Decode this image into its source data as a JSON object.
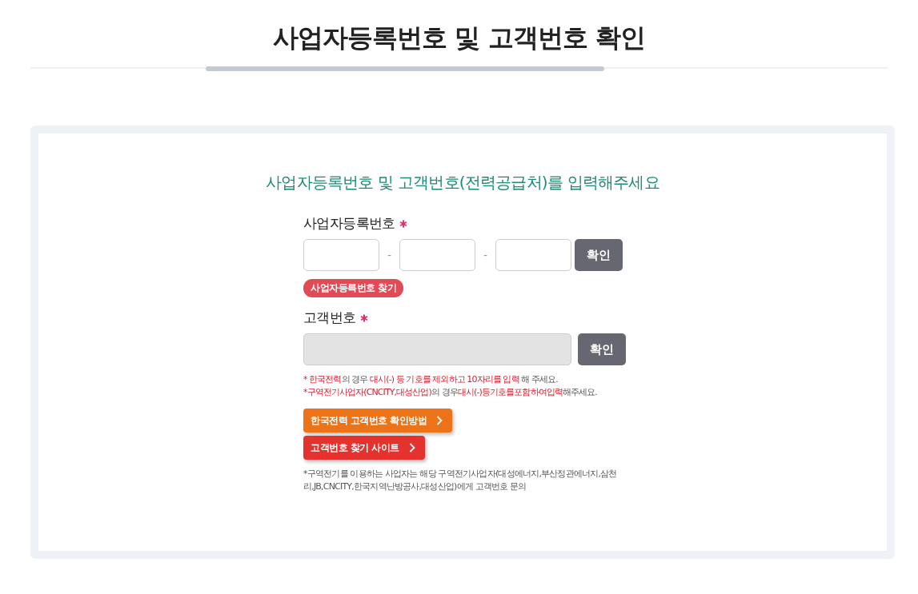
{
  "page_title": "사업자등록번호 및 고객번호 확인",
  "form": {
    "heading": "사업자등록번호 및 고객번호(전력공급처)를 입력해주세요",
    "business_number": {
      "label": "사업자등록번호",
      "required": true,
      "fields": [
        {
          "disabled": false
        },
        {
          "disabled": false
        },
        {
          "disabled": false
        }
      ],
      "separators": [
        "-",
        "-"
      ],
      "confirm_button": "확인",
      "find_badge": "사업자등록번호 찾기"
    },
    "customer_number": {
      "label": "고객번호",
      "required": true,
      "field": {
        "disabled": true
      },
      "confirm_button": "확인"
    },
    "notes": [
      [
        {
          "text": "* 한국전력",
          "highlight": true
        },
        {
          "text": "의 경우 ",
          "highlight": false
        },
        {
          "text": "대시(-) 등 기호를 제외하고 10자리를 입력",
          "highlight": true
        },
        {
          "text": " 해 주세요.",
          "highlight": false
        }
      ],
      [
        {
          "text": "*구역전기사업자(CNCITY,대성산업)",
          "highlight": true
        },
        {
          "text": "의 경우",
          "highlight": false
        },
        {
          "text": "대시(-)등기호를포함하여입력",
          "highlight": true
        },
        {
          "text": "해주세요.",
          "highlight": false
        }
      ]
    ],
    "link_buttons": [
      {
        "label": "한국전력 고객번호 확인방법",
        "color": "#ec7317"
      },
      {
        "label": "고객번호 찾기 사이트",
        "color": "#e4322f"
      }
    ],
    "footnote": "*구역전기를 이용하는 사업자는 해당 구역전기사업자(대성에너지,부산정관에너지,삼천리,JB,CNCITY,한국지역난방공사,대성산업)에게 고객번호 문의"
  }
}
